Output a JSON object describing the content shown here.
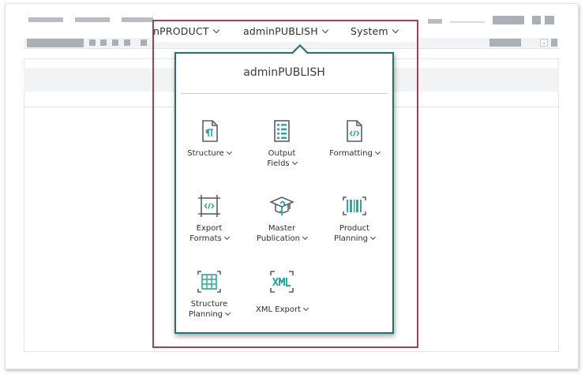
{
  "menubar": {
    "items": [
      {
        "label": "nPRODUCT"
      },
      {
        "label": "adminPUBLISH"
      },
      {
        "label": "System"
      }
    ]
  },
  "dropdown": {
    "title": "adminPUBLISH",
    "tiles": [
      {
        "lines": [
          "Structure"
        ],
        "icon": "structure-document-icon"
      },
      {
        "lines": [
          "Output",
          "Fields"
        ],
        "icon": "output-fields-icon"
      },
      {
        "lines": [
          "Formatting"
        ],
        "icon": "formatting-code-icon"
      },
      {
        "lines": [
          "Export",
          "Formats"
        ],
        "icon": "export-formats-icon"
      },
      {
        "lines": [
          "Master",
          "Publication"
        ],
        "icon": "master-publication-icon"
      },
      {
        "lines": [
          "Product",
          "Planning"
        ],
        "icon": "barcode-icon"
      },
      {
        "lines": [
          "Structure",
          "Planning"
        ],
        "icon": "grid-table-icon"
      },
      {
        "lines": [
          "XML Export"
        ],
        "icon": "xml-export-icon"
      }
    ]
  },
  "colors": {
    "highlight_border": "#b23a55",
    "panel_border": "#2a6f6b",
    "icon_accent": "#2fa6a0",
    "icon_gray": "#5b5f63"
  }
}
